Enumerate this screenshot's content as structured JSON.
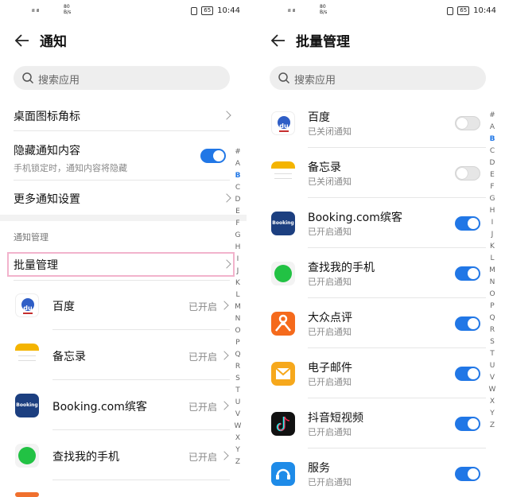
{
  "status": {
    "signal": "ᵢₗₗ ᵢₗₗ",
    "speed_top": "80",
    "speed_bottom": "B/s",
    "battery": "65",
    "time": "10:44"
  },
  "left": {
    "title": "通知",
    "search_placeholder": "搜索应用",
    "settings": [
      {
        "label": "桌面图标角标"
      },
      {
        "label": "隐藏通知内容",
        "sub": "手机锁定时，通知内容将隐藏",
        "toggle": true
      },
      {
        "label": "更多通知设置"
      }
    ],
    "section_header": "通知管理",
    "batch_label": "批量管理",
    "apps": [
      {
        "name": "百度",
        "state": "已开启",
        "icon": "baidu-icon"
      },
      {
        "name": "备忘录",
        "state": "已开启",
        "icon": "memo-icon"
      },
      {
        "name": "Booking.com缤客",
        "state": "已开启",
        "icon": "booking-icon"
      },
      {
        "name": "查找我的手机",
        "state": "已开启",
        "icon": "find-phone-icon"
      }
    ],
    "alphabet": [
      "#",
      "A",
      "B",
      "C",
      "D",
      "E",
      "F",
      "G",
      "H",
      "I",
      "J",
      "K",
      "L",
      "M",
      "N",
      "O",
      "P",
      "Q",
      "R",
      "S",
      "T",
      "U",
      "V",
      "W",
      "X",
      "Y",
      "Z"
    ],
    "active_letter": "B"
  },
  "right": {
    "title": "批量管理",
    "search_placeholder": "搜索应用",
    "apps": [
      {
        "name": "百度",
        "sub": "已关闭通知",
        "on": false,
        "icon": "baidu-icon"
      },
      {
        "name": "备忘录",
        "sub": "已关闭通知",
        "on": false,
        "icon": "memo-icon"
      },
      {
        "name": "Booking.com缤客",
        "sub": "已开启通知",
        "on": true,
        "icon": "booking-icon"
      },
      {
        "name": "查找我的手机",
        "sub": "已开启通知",
        "on": true,
        "icon": "find-phone-icon"
      },
      {
        "name": "大众点评",
        "sub": "已开启通知",
        "on": true,
        "icon": "dianping-icon"
      },
      {
        "name": "电子邮件",
        "sub": "已开启通知",
        "on": true,
        "icon": "email-icon"
      },
      {
        "name": "抖音短视频",
        "sub": "已开启通知",
        "on": true,
        "icon": "douyin-icon"
      },
      {
        "name": "服务",
        "sub": "已开启通知",
        "on": true,
        "icon": "service-icon"
      }
    ],
    "alphabet": [
      "#",
      "A",
      "B",
      "C",
      "D",
      "E",
      "F",
      "G",
      "H",
      "I",
      "J",
      "K",
      "L",
      "M",
      "N",
      "O",
      "P",
      "Q",
      "R",
      "S",
      "T",
      "U",
      "V",
      "W",
      "X",
      "Y",
      "Z"
    ],
    "active_letter": "B"
  },
  "colors": {
    "accent": "#2177e6",
    "highlight_border": "#f2b3cc"
  }
}
